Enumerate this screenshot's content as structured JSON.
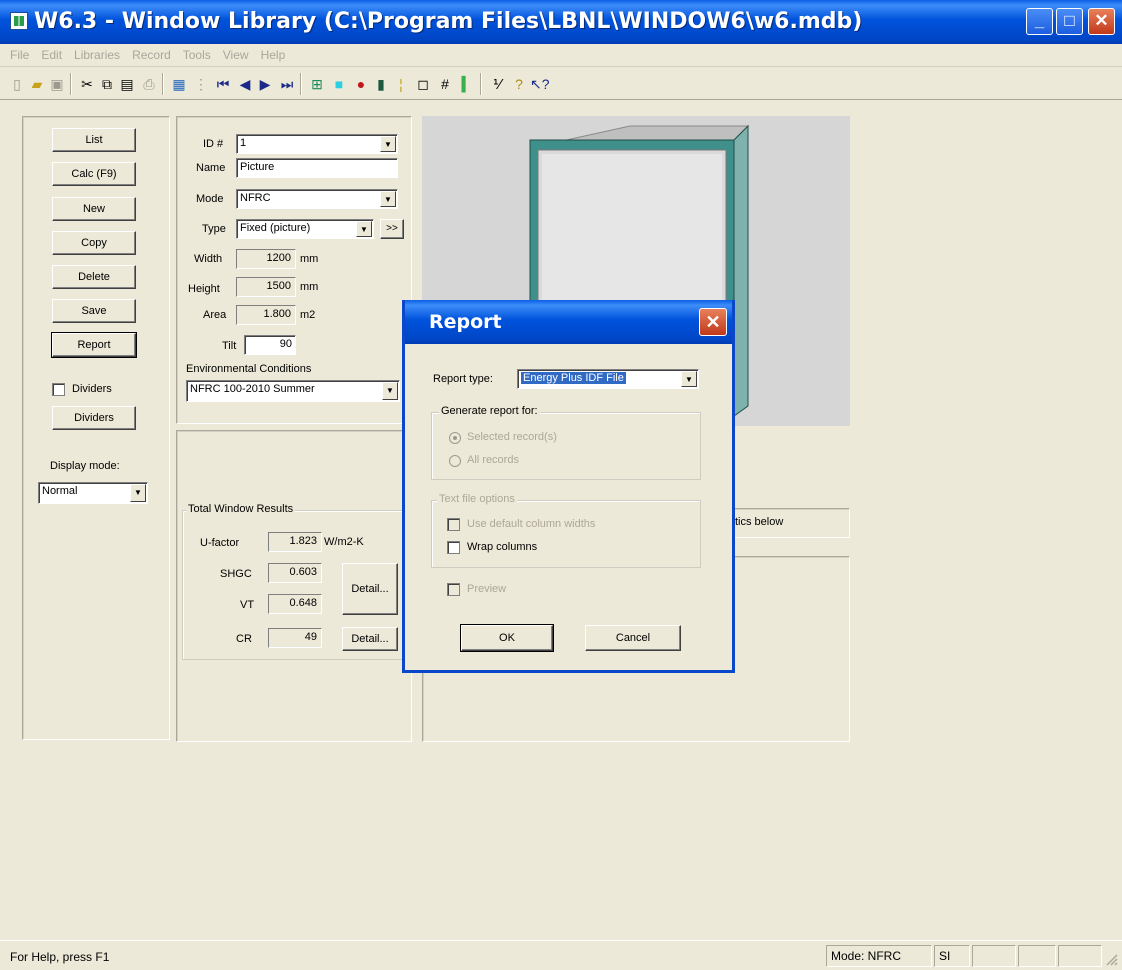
{
  "window": {
    "title": "W6.3 - Window Library (C:\\Program Files\\LBNL\\WINDOW6\\w6.mdb)"
  },
  "menu": [
    "File",
    "Edit",
    "Libraries",
    "Record",
    "Tools",
    "View",
    "Help"
  ],
  "left_buttons": {
    "list": "List",
    "calc": "Calc (F9)",
    "new": "New",
    "copy": "Copy",
    "delete": "Delete",
    "save": "Save",
    "report": "Report",
    "dividers_check": "Dividers",
    "dividers_button": "Dividers",
    "display_mode_label": "Display mode:",
    "display_mode_value": "Normal"
  },
  "fields": {
    "id_label": "ID #",
    "id_value": "1",
    "name_label": "Name",
    "name_value": "Picture",
    "mode_label": "Mode",
    "mode_value": "NFRC",
    "type_label": "Type",
    "type_value": "Fixed (picture)",
    "type_more": ">>",
    "width_label": "Width",
    "width_value": "1200",
    "width_unit": "mm",
    "height_label": "Height",
    "height_value": "1500",
    "height_unit": "mm",
    "area_label": "Area",
    "area_value": "1.800",
    "area_unit": "m2",
    "tilt_label": "Tilt",
    "tilt_value": "90",
    "env_label": "Environmental Conditions",
    "env_value": "NFRC 100-2010 Summer"
  },
  "results": {
    "group_title": "Total Window Results",
    "ufactor_label": "U-factor",
    "ufactor_value": "1.823",
    "ufactor_unit": "W/m2-K",
    "shgc_label": "SHGC",
    "shgc_value": "0.603",
    "vt_label": "VT",
    "vt_value": "0.648",
    "detail_button": "Detail...",
    "cr_label": "CR",
    "cr_value": "49",
    "cr_detail_button": "Detail..."
  },
  "right_panel": {
    "partial_text": "tics below"
  },
  "dialog": {
    "title": "Report",
    "report_type_label": "Report type:",
    "report_type_value": "Energy Plus IDF File",
    "generate_group": "Generate report for:",
    "selected_records": "Selected record(s)",
    "all_records": "All records",
    "text_options_group": "Text file options",
    "use_default_widths": "Use default column widths",
    "wrap_columns": "Wrap columns",
    "preview": "Preview",
    "ok": "OK",
    "cancel": "Cancel"
  },
  "status": {
    "help": "For Help, press F1",
    "mode": "Mode: NFRC",
    "units": "SI"
  },
  "colors": {
    "titlebar": "#0052dc",
    "face": "#ece9d8",
    "selection": "#316ac5",
    "frame_green": "#3f8f8a"
  },
  "toolbar_icons": [
    "new-icon",
    "open-icon",
    "save-icon",
    "cut-icon",
    "copy-icon",
    "paste-icon",
    "print-icon",
    "grid-icon",
    "list-icon",
    "first-record-icon",
    "prev-record-icon",
    "next-record-icon",
    "last-record-icon",
    "frame-icon",
    "glazing-icon",
    "shading-icon",
    "divider-icon",
    "gap-icon",
    "glass-icon",
    "pane-count-icon",
    "bar-icon",
    "fraction-icon",
    "help-icon",
    "context-help-icon"
  ]
}
